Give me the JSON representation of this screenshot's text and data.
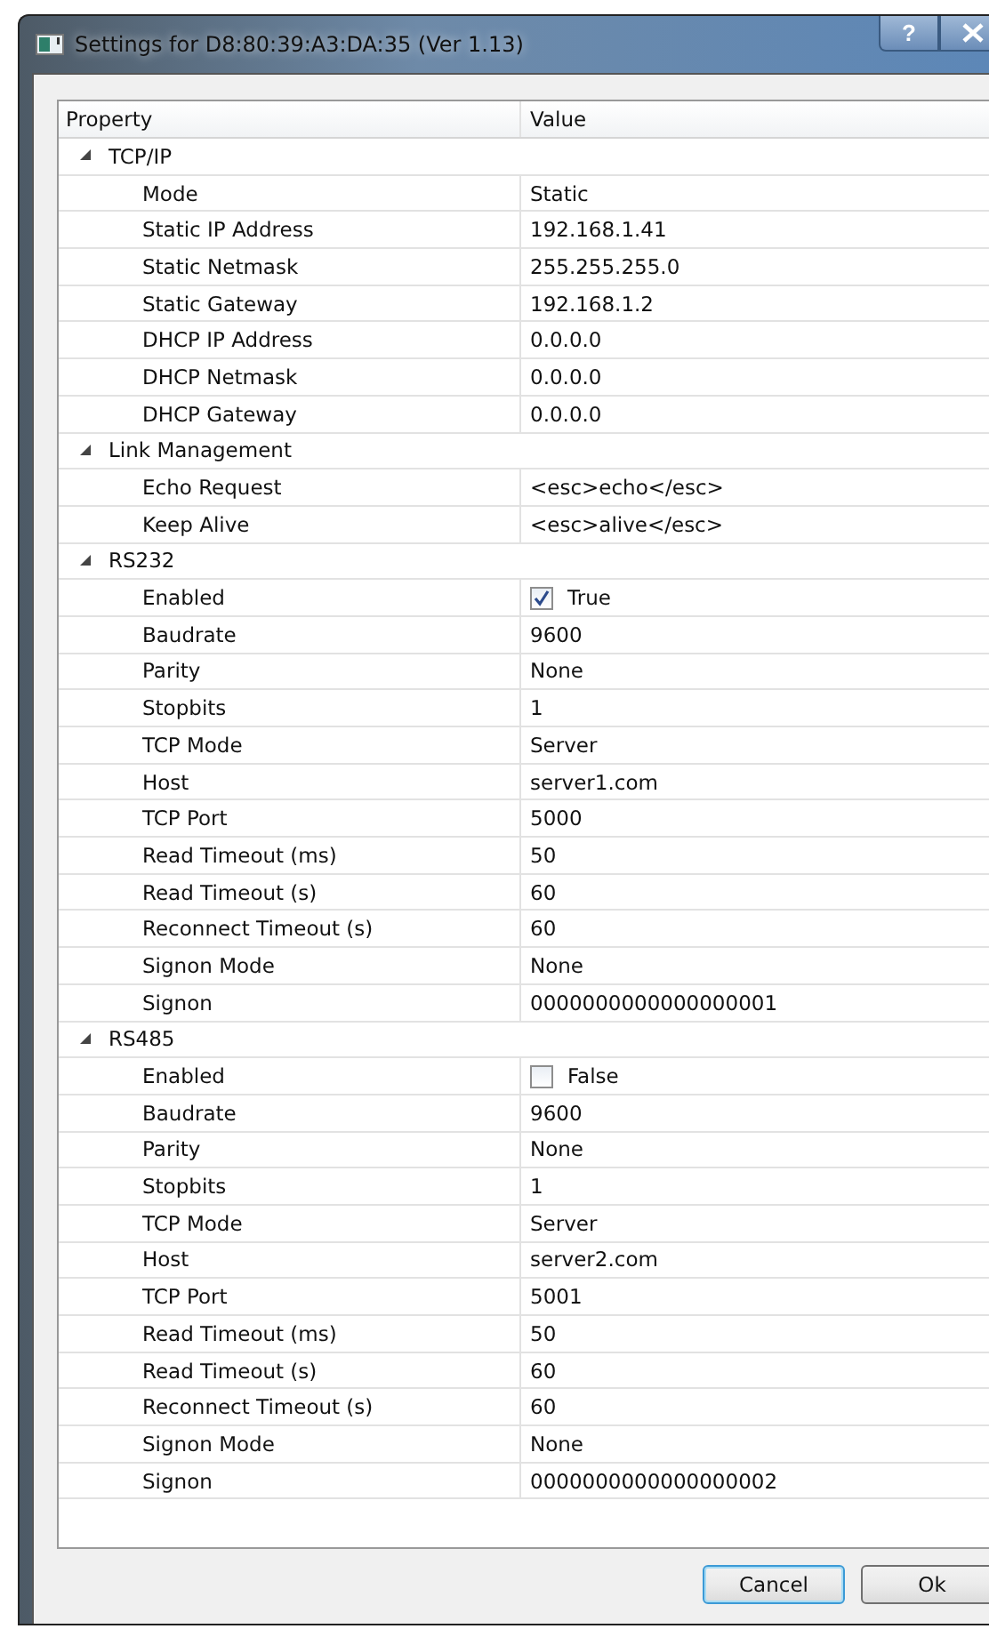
{
  "window": {
    "title": "Settings for D8:80:39:A3:DA:35 (Ver 1.13)",
    "help_button": "?"
  },
  "table": {
    "columns": [
      "Property",
      "Value"
    ],
    "groups": [
      {
        "name": "TCP/IP",
        "expanded": true,
        "children": [
          {
            "name": "Mode",
            "kind": "text",
            "value": "Static"
          },
          {
            "name": "Static IP Address",
            "kind": "text",
            "value": "192.168.1.41"
          },
          {
            "name": "Static Netmask",
            "kind": "text",
            "value": "255.255.255.0"
          },
          {
            "name": "Static Gateway",
            "kind": "text",
            "value": "192.168.1.2"
          },
          {
            "name": "DHCP IP Address",
            "kind": "text",
            "value": "0.0.0.0"
          },
          {
            "name": "DHCP Netmask",
            "kind": "text",
            "value": "0.0.0.0"
          },
          {
            "name": "DHCP Gateway",
            "kind": "text",
            "value": "0.0.0.0"
          }
        ]
      },
      {
        "name": "Link Management",
        "expanded": true,
        "children": [
          {
            "name": "Echo Request",
            "kind": "text",
            "value": "<esc>echo</esc>"
          },
          {
            "name": "Keep Alive",
            "kind": "text",
            "value": "<esc>alive</esc>"
          }
        ]
      },
      {
        "name": "RS232",
        "expanded": true,
        "children": [
          {
            "name": "Enabled",
            "kind": "checkbox",
            "checked": true,
            "value": "True"
          },
          {
            "name": "Baudrate",
            "kind": "text",
            "value": "9600"
          },
          {
            "name": "Parity",
            "kind": "text",
            "value": "None"
          },
          {
            "name": "Stopbits",
            "kind": "text",
            "value": "1"
          },
          {
            "name": "TCP Mode",
            "kind": "text",
            "value": "Server"
          },
          {
            "name": "Host",
            "kind": "text",
            "value": "server1.com"
          },
          {
            "name": "TCP Port",
            "kind": "text",
            "value": "5000"
          },
          {
            "name": "Read Timeout (ms)",
            "kind": "text",
            "value": "50"
          },
          {
            "name": "Read Timeout (s)",
            "kind": "text",
            "value": "60"
          },
          {
            "name": "Reconnect Timeout (s)",
            "kind": "text",
            "value": "60"
          },
          {
            "name": "Signon Mode",
            "kind": "text",
            "value": "None"
          },
          {
            "name": "Signon",
            "kind": "text",
            "value": "0000000000000000001"
          }
        ]
      },
      {
        "name": "RS485",
        "expanded": true,
        "children": [
          {
            "name": "Enabled",
            "kind": "checkbox",
            "checked": false,
            "value": "False"
          },
          {
            "name": "Baudrate",
            "kind": "text",
            "value": "9600"
          },
          {
            "name": "Parity",
            "kind": "text",
            "value": "None"
          },
          {
            "name": "Stopbits",
            "kind": "text",
            "value": "1"
          },
          {
            "name": "TCP Mode",
            "kind": "text",
            "value": "Server"
          },
          {
            "name": "Host",
            "kind": "text",
            "value": "server2.com"
          },
          {
            "name": "TCP Port",
            "kind": "text",
            "value": "5001"
          },
          {
            "name": "Read Timeout (ms)",
            "kind": "text",
            "value": "50"
          },
          {
            "name": "Read Timeout (s)",
            "kind": "text",
            "value": "60"
          },
          {
            "name": "Reconnect Timeout (s)",
            "kind": "text",
            "value": "60"
          },
          {
            "name": "Signon Mode",
            "kind": "text",
            "value": "None"
          },
          {
            "name": "Signon",
            "kind": "text",
            "value": "0000000000000000002"
          }
        ]
      }
    ]
  },
  "buttons": [
    "Cancel",
    "Ok"
  ]
}
